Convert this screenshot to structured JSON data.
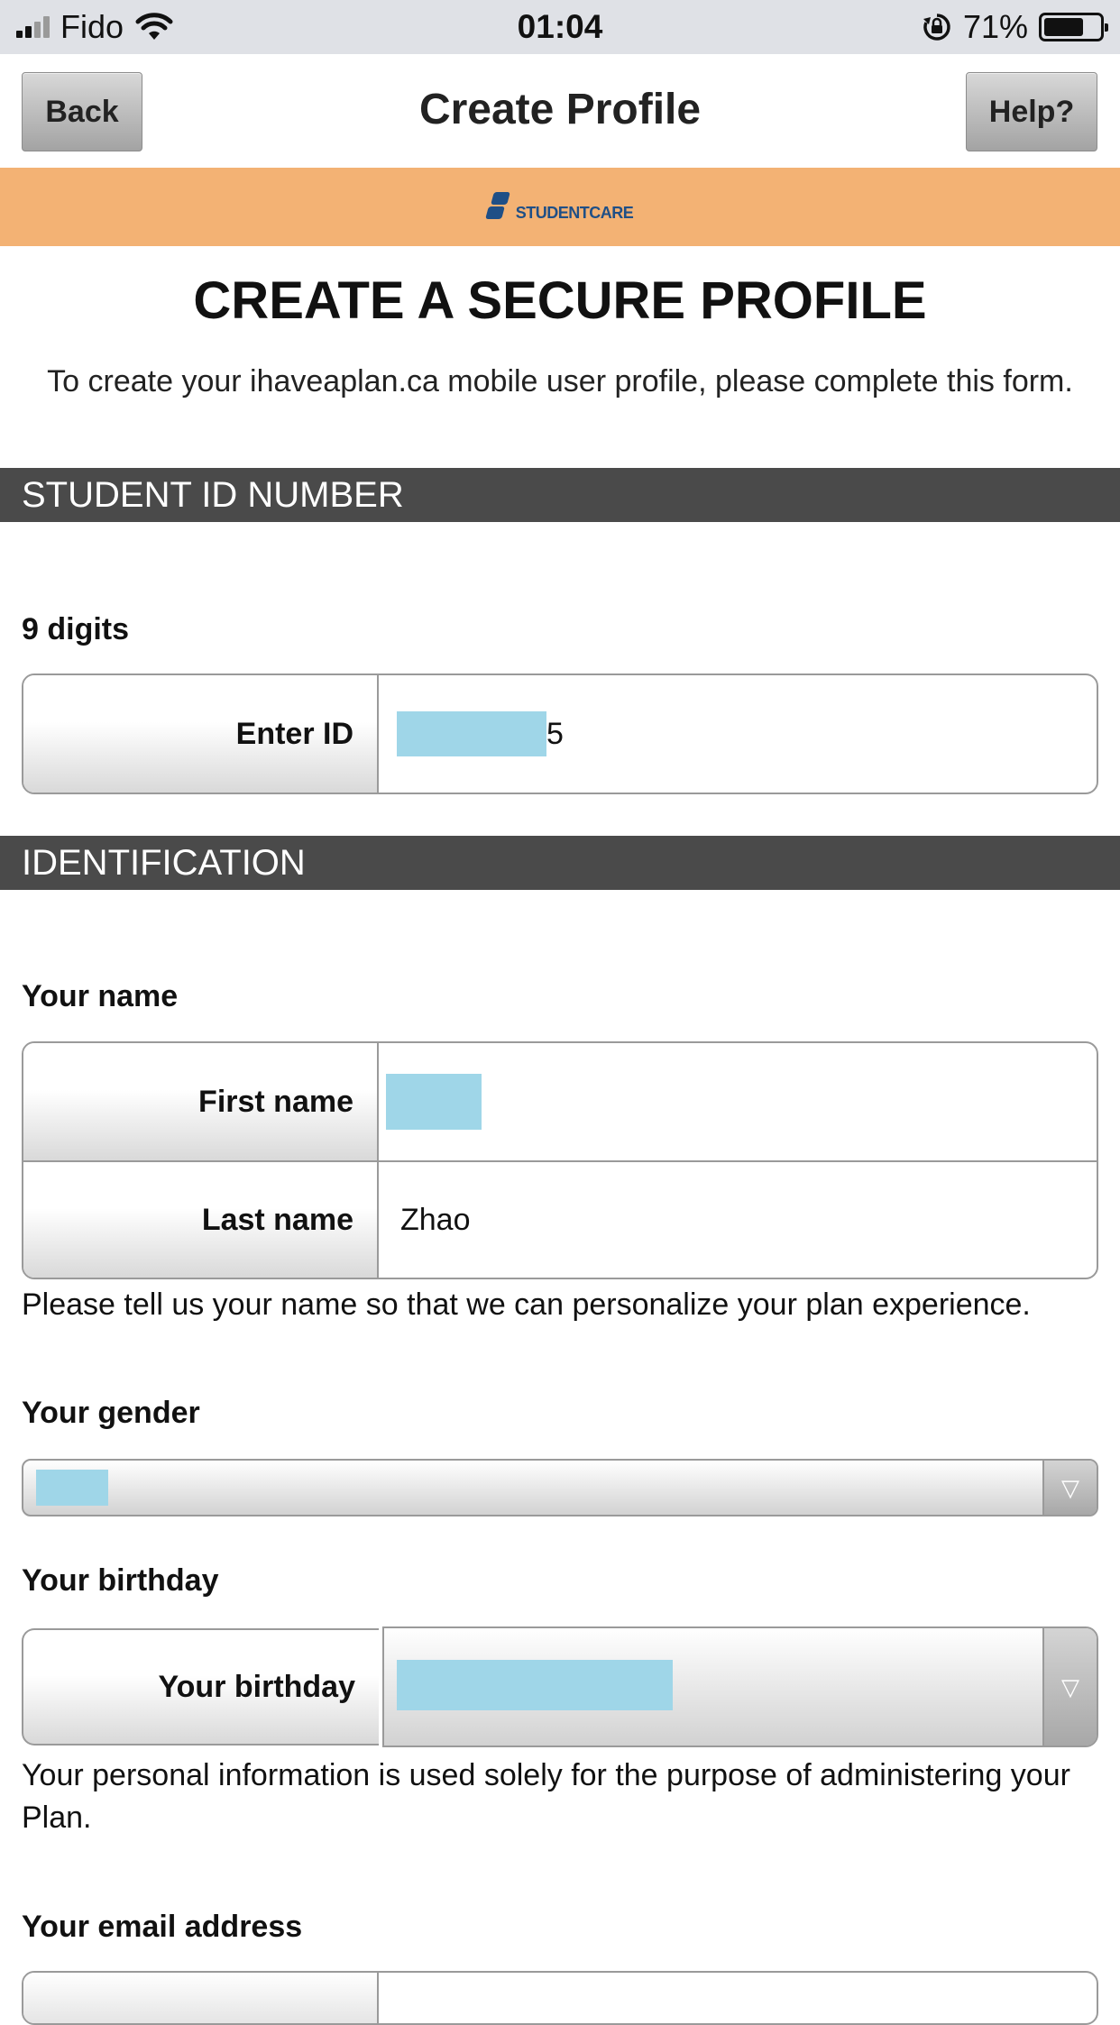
{
  "status_bar": {
    "carrier": "Fido",
    "time": "01:04",
    "battery": "71%",
    "battery_level": 0.71
  },
  "nav": {
    "back_label": "Back",
    "title": "Create Profile",
    "help_label": "Help?"
  },
  "brand": {
    "logo_text": "STUDENTCARE",
    "background_color": "#f3b274"
  },
  "page": {
    "heading": "CREATE A SECURE PROFILE",
    "intro": "To create your ihaveaplan.ca mobile user profile, please complete this form."
  },
  "student_id": {
    "section_title": "STUDENT ID NUMBER",
    "hint": "9 digits",
    "field_label": "Enter ID",
    "visible_value": "5"
  },
  "identification": {
    "section_title": "IDENTIFICATION",
    "name_label": "Your name",
    "first_name_label": "First name",
    "last_name_label": "Last name",
    "last_name_value": "Zhao",
    "name_help": "Please tell us your name so that we can personalize your plan experience.",
    "gender_label": "Your gender",
    "birthday_heading": "Your birthday",
    "birthday_field_label": "Your birthday",
    "privacy_note": "Your personal information is used solely for the purpose of administering your Plan.",
    "email_label": "Your email address"
  },
  "icons": {
    "select_arrow": "chevron-down-icon",
    "wifi": "wifi-icon",
    "rotation_lock": "rotation-lock-icon",
    "battery": "battery-icon",
    "signal": "signal-icon"
  },
  "colors": {
    "section_bar": "#4a4a4a",
    "redaction": "#9fd6e8"
  }
}
